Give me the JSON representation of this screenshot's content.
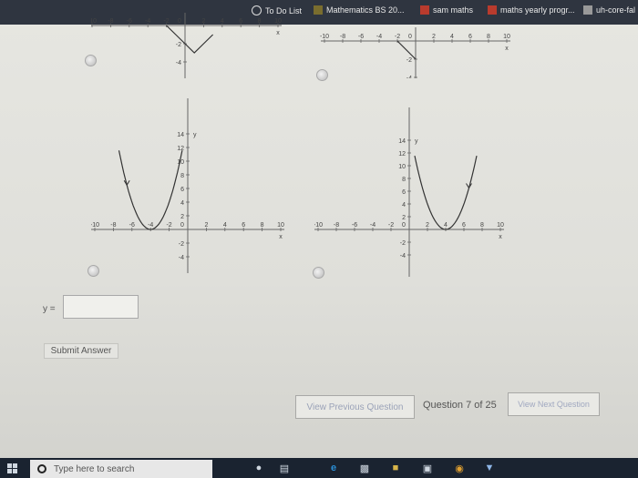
{
  "bookmarks": [
    {
      "label": "To Do List",
      "icon": "clock-icon"
    },
    {
      "label": "Mathematics BS 20...",
      "icon": "bookmark-icon"
    },
    {
      "label": "sam maths",
      "icon": "bookmark-icon"
    },
    {
      "label": "maths yearly progr...",
      "icon": "bookmark-icon"
    },
    {
      "label": "uh-core-fal",
      "icon": "bookmark-icon"
    }
  ],
  "graph_labels": {
    "x_ticks": [
      "-10",
      "-8",
      "-6",
      "-4",
      "-2",
      "0",
      "2",
      "4",
      "6",
      "8",
      "10"
    ],
    "y_ticks_top": [
      "-2",
      "-4"
    ],
    "y_ticks_bottom": [
      "14",
      "12",
      "10",
      "8",
      "6",
      "4",
      "2",
      "-2",
      "-4"
    ],
    "x_axis": "x",
    "y_axis": "y"
  },
  "answer": {
    "label": "y =",
    "value": ""
  },
  "submit_label": "Submit Answer",
  "navigation": {
    "prev_label": "View Previous Question",
    "question_counter": "Question 7 of 25",
    "next_label": "View Next Question"
  },
  "taskbar": {
    "search_placeholder": "Type here to search"
  },
  "colors": {
    "taskbar": "#1a2330",
    "bookmarks_bar": "#2f3540",
    "page": "#e2e2dd"
  },
  "chart_data": [
    {
      "type": "line",
      "option": "A",
      "title": "",
      "xlabel": "x",
      "ylabel": "",
      "xlim": [
        -10,
        10
      ],
      "ylim": [
        -4,
        0
      ],
      "series": [
        {
          "x": [
            -2,
            -1,
            0,
            1,
            2,
            3
          ],
          "y": [
            0,
            -1,
            -2,
            -3,
            -2,
            -1
          ]
        }
      ]
    },
    {
      "type": "line",
      "option": "B",
      "title": "",
      "xlabel": "x",
      "ylabel": "",
      "xlim": [
        -10,
        10
      ],
      "ylim": [
        -4,
        0
      ],
      "series": [
        {
          "x": [
            -2,
            -1,
            0
          ],
          "y": [
            0,
            -1,
            -2
          ]
        }
      ]
    },
    {
      "type": "line",
      "option": "C",
      "title": "",
      "xlabel": "x",
      "ylabel": "y",
      "xlim": [
        -10,
        10
      ],
      "ylim": [
        -4,
        15
      ],
      "series": [
        {
          "x": [
            -7.4,
            -6,
            -5,
            -4,
            -3,
            -2,
            -1,
            -0.6
          ],
          "y": [
            15,
            4,
            1,
            0,
            1,
            4,
            9,
            11.56
          ]
        }
      ]
    },
    {
      "type": "line",
      "option": "D",
      "title": "",
      "xlabel": "x",
      "ylabel": "y",
      "xlim": [
        -10,
        10
      ],
      "ylim": [
        -4,
        15
      ],
      "series": [
        {
          "x": [
            0.6,
            1,
            2,
            3,
            4,
            5,
            6,
            7.4
          ],
          "y": [
            11.56,
            9,
            4,
            1,
            0,
            1,
            4,
            15
          ]
        }
      ]
    }
  ]
}
